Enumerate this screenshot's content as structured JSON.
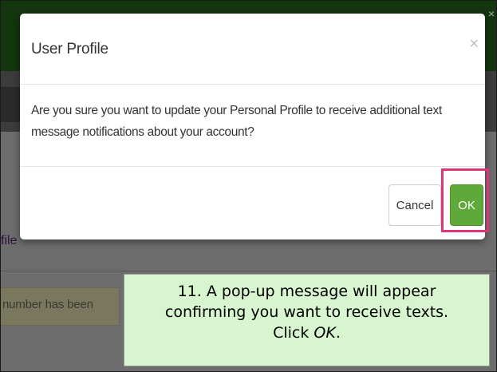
{
  "background": {
    "profile_link_text": "file",
    "alert_text": "number has been",
    "corner_close": "×"
  },
  "modal": {
    "title": "User Profile",
    "close_glyph": "×",
    "message": "Are you sure you want to update your Personal Profile to receive additional text message notifications about your account?",
    "cancel_label": "Cancel",
    "ok_label": "OK"
  },
  "callout": {
    "line1": "11. A pop-up message will appear",
    "line2": "confirming you want to receive texts.",
    "line3_prefix": "Click ",
    "line3_emphasis": "OK",
    "line3_suffix": "."
  },
  "colors": {
    "header_green": "#14360f",
    "ok_green": "#5fa83a",
    "highlight_pink": "#e0337a",
    "callout_green": "#d7f5cf"
  }
}
